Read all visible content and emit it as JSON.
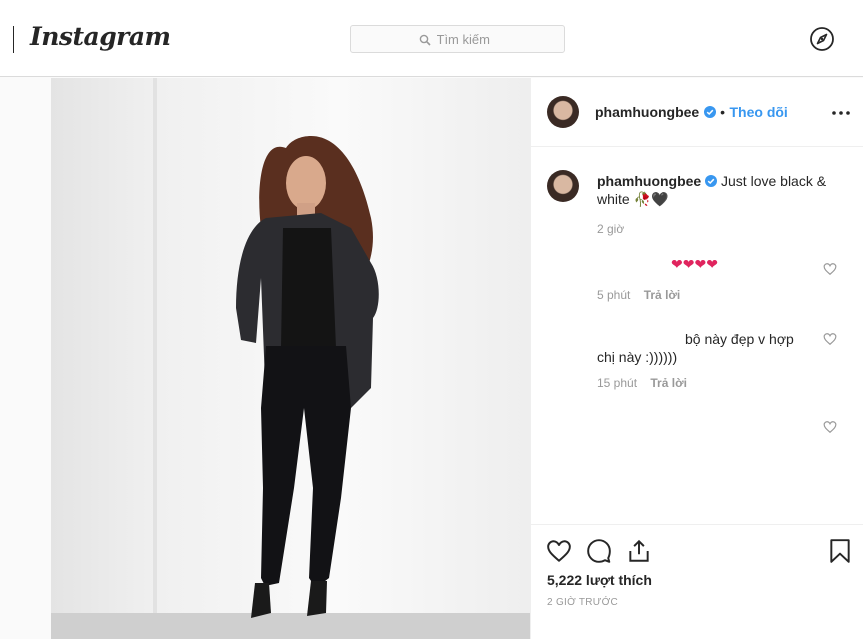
{
  "header": {
    "logo": "Instagram",
    "search_placeholder": "Tìm kiếm",
    "explore_icon": "compass-icon"
  },
  "post": {
    "username": "phamhuongbee",
    "follow_label": "Theo dõi",
    "caption": {
      "username": "phamhuongbee",
      "text": "Just love black & white",
      "emoji": "🥀🖤",
      "time": "2 giờ"
    },
    "comments": [
      {
        "text": "❤❤❤❤",
        "time": "5 phút",
        "reply_label": "Trả lời"
      },
      {
        "text_line1": "bộ này đẹp v hợp",
        "text_line2": "chị này :))))))",
        "time": "15 phút",
        "reply_label": "Trả lời"
      }
    ],
    "likes": "5,222 lượt thích",
    "posted": "2 GIỜ TRƯỚC"
  },
  "colors": {
    "accent": "#3897f0",
    "verified": "#3897f0",
    "heart": "#ed4956"
  }
}
